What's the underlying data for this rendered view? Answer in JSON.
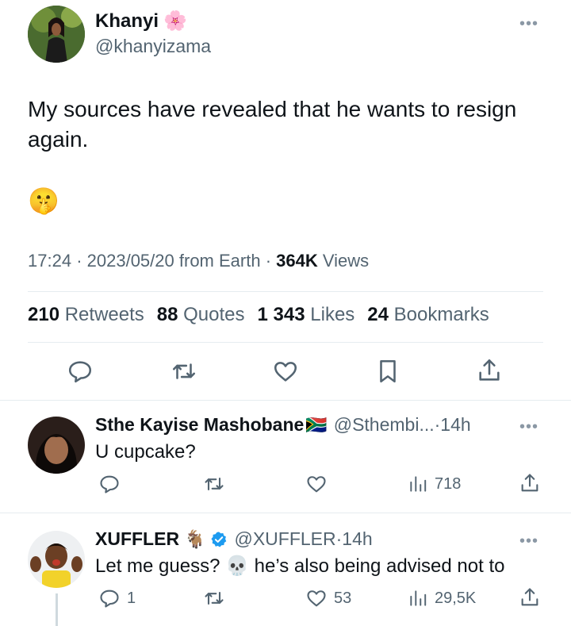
{
  "main_tweet": {
    "author_name": "Khanyi",
    "author_emoji": "🌸",
    "handle": "@khanyizama",
    "text": "My sources have revealed that he wants to resign again.",
    "emoji": "🤫",
    "time": "17:24",
    "date": "2023/05/20",
    "source": "from Earth",
    "views_count": "364K",
    "views_label": "Views",
    "stats": {
      "retweets_count": "210",
      "retweets_label": "Retweets",
      "quotes_count": "88",
      "quotes_label": "Quotes",
      "likes_count": "1 343",
      "likes_label": "Likes",
      "bookmarks_count": "24",
      "bookmarks_label": "Bookmarks"
    },
    "icons": [
      "reply-icon",
      "retweet-icon",
      "like-icon",
      "bookmark-icon",
      "share-icon"
    ]
  },
  "replies": [
    {
      "name": "Sthe Kayise Mashobane",
      "flag": "🇿🇦",
      "handle": "@Sthembi...",
      "time": "14h",
      "text": "U cupcake?",
      "views": "718"
    },
    {
      "name": "XUFFLER",
      "name_emoji": "🐐",
      "verified": true,
      "handle": "@XUFFLER",
      "time": "14h",
      "text_before": "Let me guess? ",
      "text_emoji": "💀",
      "text_after": " he’s also being advised not to",
      "replies": "1",
      "likes": "53",
      "views": "29,5K"
    }
  ],
  "colors": {
    "muted": "#536471",
    "verified": "#1d9bf0",
    "divider": "#e6ecf0"
  }
}
